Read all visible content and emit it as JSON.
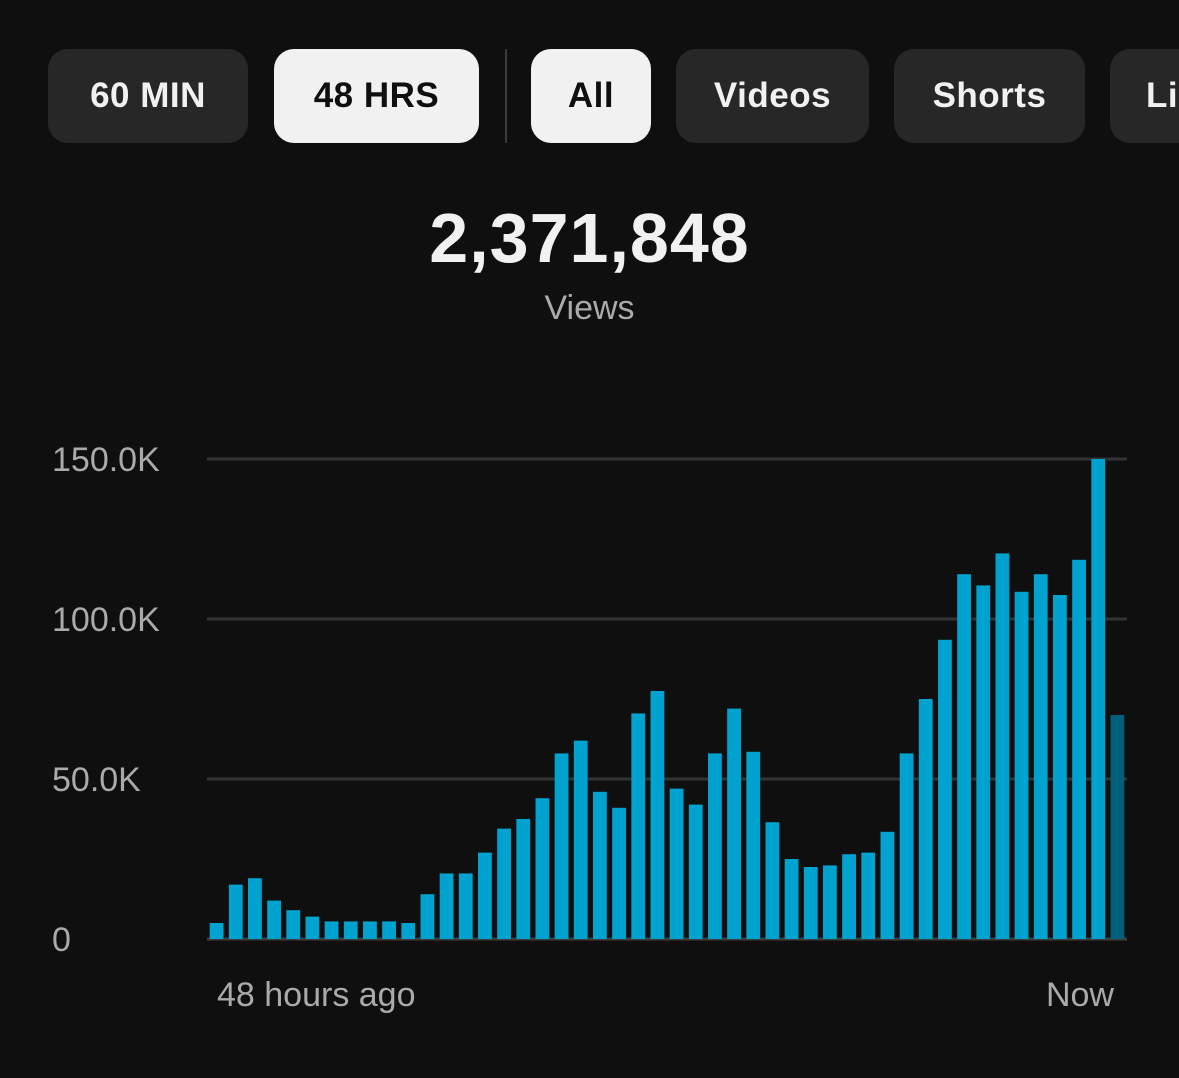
{
  "filters": {
    "time_ranges": [
      {
        "label": "60 MIN",
        "selected": false
      },
      {
        "label": "48 HRS",
        "selected": true
      }
    ],
    "content_types": [
      {
        "label": "All",
        "selected": true
      },
      {
        "label": "Videos",
        "selected": false
      },
      {
        "label": "Shorts",
        "selected": false
      },
      {
        "label": "Li",
        "selected": false
      }
    ]
  },
  "summary": {
    "total": "2,371,848",
    "label": "Views"
  },
  "colors": {
    "bar": "#00a2d0",
    "bar_partial": "#005f7a",
    "background": "#0f0f0f",
    "chip": "#272727",
    "chip_selected": "#f1f1f1"
  },
  "chart_data": {
    "type": "bar",
    "ylim": [
      0,
      150000
    ],
    "y_ticks": [
      {
        "value": 0,
        "label": "0"
      },
      {
        "value": 50000,
        "label": "50.0K"
      },
      {
        "value": 100000,
        "label": "100.0K"
      },
      {
        "value": 150000,
        "label": "150.0K"
      }
    ],
    "x_start_label": "48 hours ago",
    "x_end_label": "Now",
    "grid": true,
    "values": [
      5000,
      17000,
      19000,
      12000,
      9000,
      7000,
      5500,
      5500,
      5500,
      5500,
      5000,
      14000,
      20500,
      20500,
      27000,
      34500,
      37500,
      44000,
      58000,
      62000,
      46000,
      41000,
      70500,
      77500,
      47000,
      42000,
      58000,
      72000,
      58500,
      36500,
      25000,
      22500,
      23000,
      26500,
      27000,
      33500,
      58000,
      75000,
      93500,
      114000,
      110500,
      120500,
      108500,
      114000,
      107500,
      118500,
      150000,
      70000
    ],
    "partial_last_bar": true
  }
}
